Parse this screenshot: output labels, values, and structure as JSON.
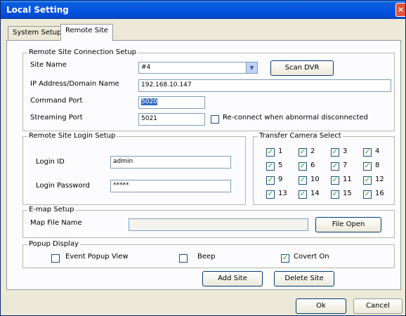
{
  "window": {
    "title": "Local Setting",
    "close_glyph": "×"
  },
  "tabs": [
    {
      "label": "System Setup"
    },
    {
      "label": "Remote Site"
    }
  ],
  "connection": {
    "legend": "Remote Site Connection Setup",
    "site_name_label": "Site Name",
    "site_name_value": "#4",
    "scan_button": "Scan DVR",
    "ip_label": "IP Address/Domain Name",
    "ip_value": "192.168.10.147",
    "command_port_label": "Command Port",
    "command_port_value": "5020",
    "streaming_port_label": "Streaming Port",
    "streaming_port_value": "5021",
    "reconnect_label": "Re-connect when abnormal disconnected",
    "reconnect_checked": false
  },
  "login": {
    "legend": "Remote Site Login Setup",
    "id_label": "Login ID",
    "id_value": "admin",
    "password_label": "Login Password",
    "password_value": "*****"
  },
  "cameras": {
    "legend": "Transfer Camera Select",
    "check_glyph": "✓",
    "items": [
      "1",
      "2",
      "3",
      "4",
      "5",
      "6",
      "7",
      "8",
      "9",
      "10",
      "11",
      "12",
      "13",
      "14",
      "15",
      "16"
    ]
  },
  "emap": {
    "legend": "E-map Setup",
    "file_label": "Map File Name",
    "file_value": "",
    "open_button": "File Open"
  },
  "popup": {
    "legend": "Popup Display",
    "event_label": "Event Popup View",
    "beep_label": "Beep",
    "covert_label": "Covert On"
  },
  "actions": {
    "add_site": "Add Site",
    "delete_site": "Delete Site",
    "ok": "Ok",
    "cancel": "Cancel"
  }
}
